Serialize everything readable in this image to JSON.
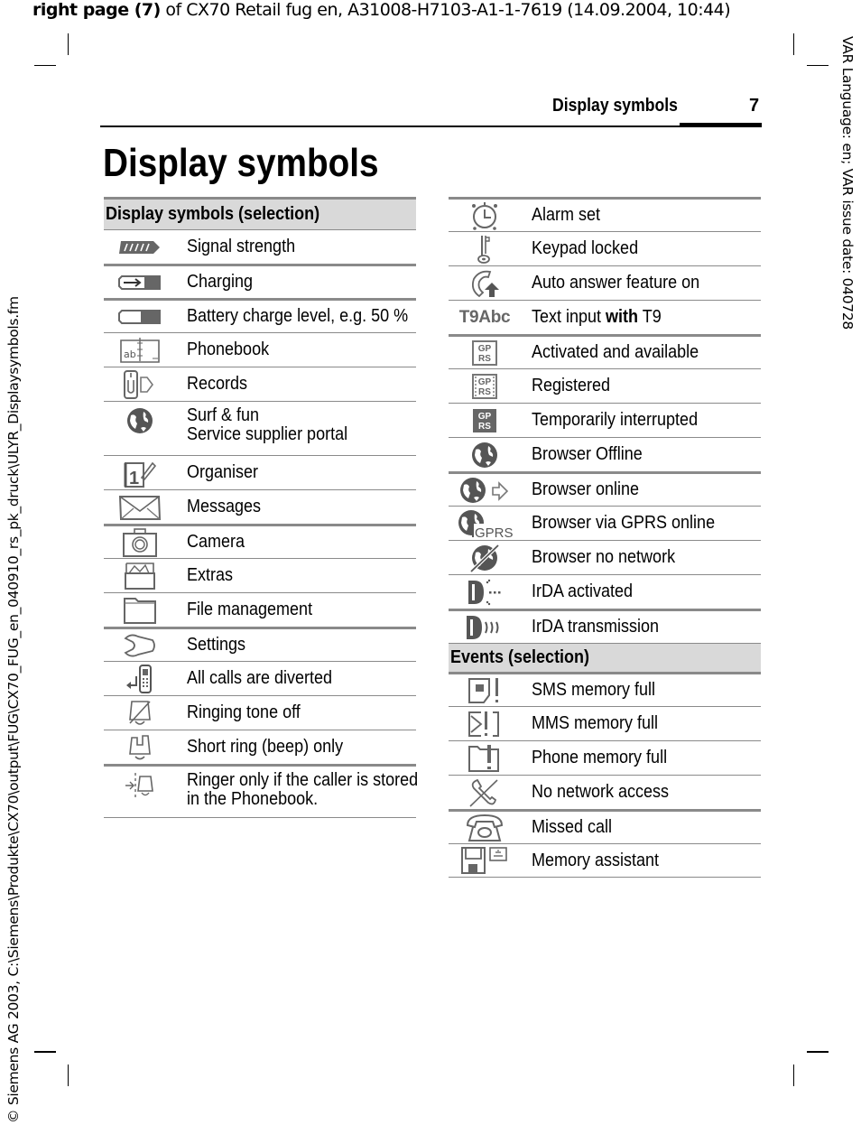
{
  "slug": {
    "bold": "right page (7)",
    "rest": " of CX70 Retail fug en, A31008-H7103-A1-1-7619 (14.09.2004, 10:44)"
  },
  "side_right": "VAR Language: en; VAR issue date: 040728",
  "side_left": "© Siemens AG 2003, C:\\Siemens\\Produkte\\CX70\\output\\FUG\\CX70_FUG_en_040910_rs_pk_druck\\ULYR_Displaysymbols.fm",
  "header": {
    "running_title": "Display symbols",
    "page_number": "7"
  },
  "title": "Display symbols",
  "left_table": {
    "heading": "Display symbols (selection)",
    "rows": [
      {
        "icon": "signal-strength-icon",
        "label": "Signal strength"
      },
      {
        "icon": "charging-icon",
        "label": "Charging"
      },
      {
        "icon": "battery-icon",
        "label": "Battery charge level, e.g. 50 %"
      },
      {
        "icon": "phonebook-icon",
        "label": "Phonebook"
      },
      {
        "icon": "records-icon",
        "label": "Records"
      },
      {
        "icon": "globe-icon",
        "label": "Surf & fun",
        "label2": "Service supplier portal"
      },
      {
        "icon": "organiser-icon",
        "label": "Organiser"
      },
      {
        "icon": "envelope-icon",
        "label": "Messages"
      },
      {
        "icon": "camera-icon",
        "label": "Camera"
      },
      {
        "icon": "extras-icon",
        "label": "Extras"
      },
      {
        "icon": "folder-icon",
        "label": "File management"
      },
      {
        "icon": "wrench-icon",
        "label": "Settings"
      },
      {
        "icon": "call-divert-icon",
        "label": "All calls are diverted"
      },
      {
        "icon": "bell-off-icon",
        "label": "Ringing tone off"
      },
      {
        "icon": "beep-bell-icon",
        "label": "Short ring (beep) only"
      },
      {
        "icon": "phonebook-ring-icon",
        "label": "Ringer only if the caller is stored",
        "label2": "in the Phonebook."
      }
    ]
  },
  "right_table": {
    "rows": [
      {
        "icon": "alarm-clock-icon",
        "label": "Alarm set"
      },
      {
        "icon": "key-icon",
        "label": "Keypad locked"
      },
      {
        "icon": "auto-answer-icon",
        "label": "Auto answer feature on"
      },
      {
        "icon": "t9-icon",
        "icon_text": "T9Abc",
        "label_pre": "Text input ",
        "label_bold": "with",
        "label_post": " T9"
      },
      {
        "icon": "gprs-active-icon",
        "icon_text_1": "GP",
        "icon_text_2": "RS",
        "label": "Activated and available"
      },
      {
        "icon": "gprs-registered-icon",
        "icon_text_1": "GP",
        "icon_text_2": "RS",
        "label": "Registered"
      },
      {
        "icon": "gprs-interrupted-icon",
        "icon_text_1": "GP",
        "icon_text_2": "RS",
        "label": "Temporarily interrupted"
      },
      {
        "icon": "browser-offline-icon",
        "label": "Browser Offline"
      },
      {
        "icon": "browser-online-icon",
        "label": "Browser online"
      },
      {
        "icon": "browser-gprs-icon",
        "icon_text": "GPRS",
        "label": "Browser via GPRS online"
      },
      {
        "icon": "browser-no-network-icon",
        "label": "Browser no network"
      },
      {
        "icon": "irda-activated-icon",
        "label": "IrDA activated"
      },
      {
        "icon": "irda-transmission-icon",
        "label": "IrDA transmission"
      }
    ],
    "events_heading": "Events (selection)",
    "events": [
      {
        "icon": "sms-full-icon",
        "label": "SMS memory full"
      },
      {
        "icon": "mms-full-icon",
        "label": "MMS memory full"
      },
      {
        "icon": "phone-memory-full-icon",
        "label": "Phone memory full"
      },
      {
        "icon": "no-network-icon",
        "label": "No network access"
      },
      {
        "icon": "missed-call-icon",
        "label": "Missed call"
      },
      {
        "icon": "memory-assistant-icon",
        "label": "Memory assistant"
      }
    ]
  }
}
